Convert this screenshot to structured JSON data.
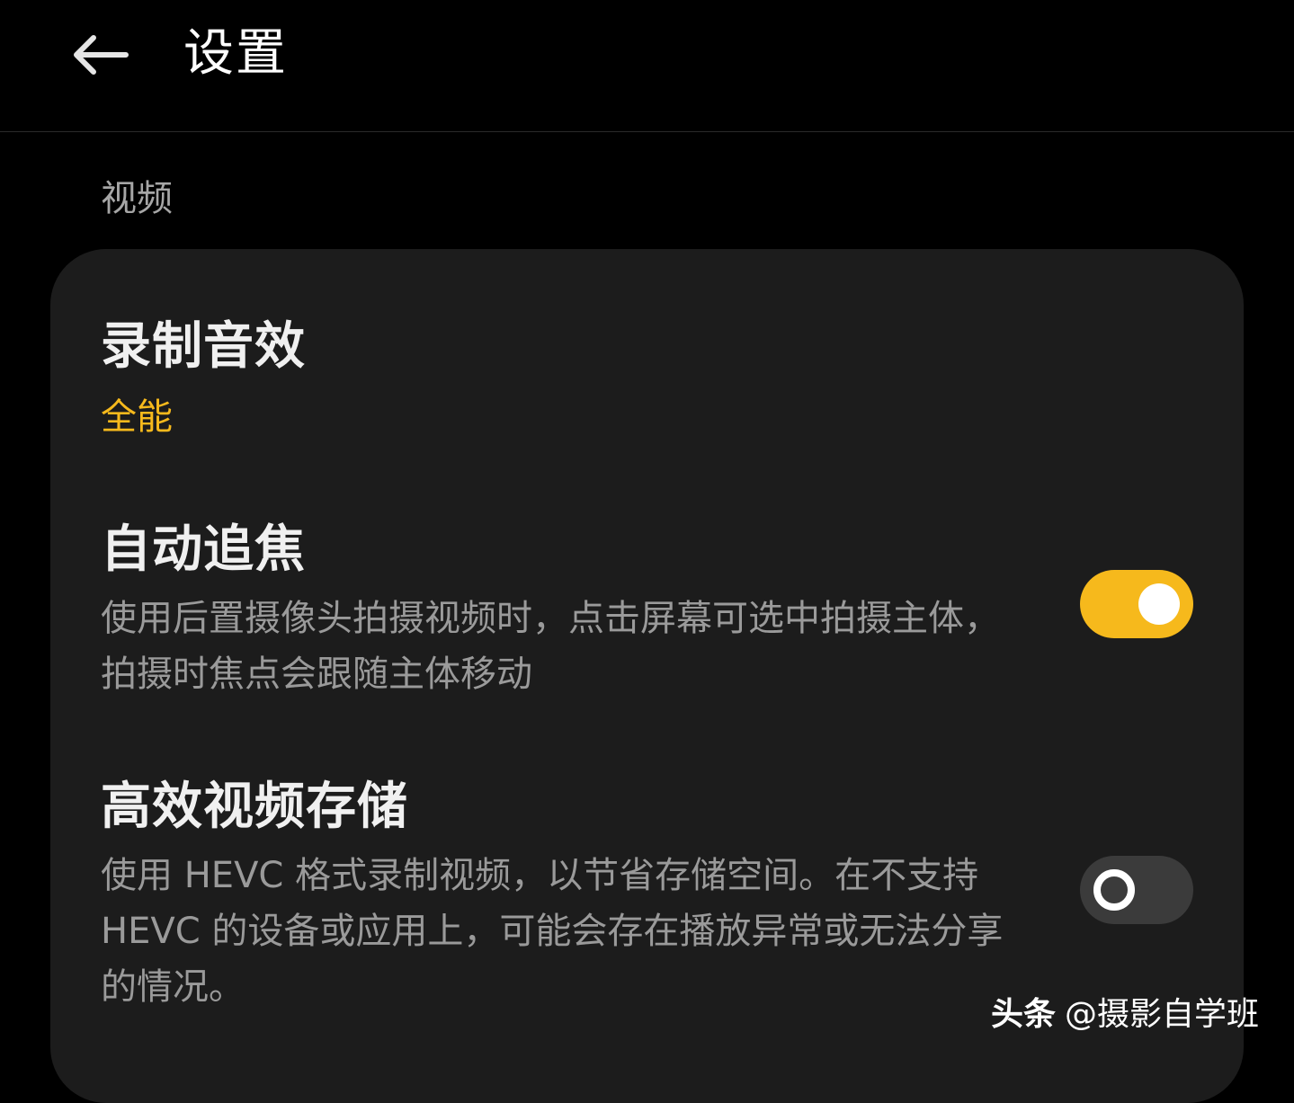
{
  "header": {
    "back_icon": "arrow-left-icon",
    "title": "设置"
  },
  "section": {
    "label": "视频"
  },
  "settings": [
    {
      "title": "录制音效",
      "value": "全能"
    },
    {
      "title": "自动追焦",
      "description": "使用后置摄像头拍摄视频时，点击屏幕可选中拍摄主体，拍摄时焦点会跟随主体移动",
      "toggle_on": true
    },
    {
      "title": "高效视频存储",
      "description": "使用 HEVC 格式录制视频，以节省存储空间。在不支持 HEVC 的设备或应用上，可能会存在播放异常或无法分享的情况。",
      "toggle_on": false
    }
  ],
  "watermark": {
    "brand": "头条",
    "handle": "@摄影自学班"
  },
  "colors": {
    "accent": "#f6b91c",
    "background": "#000000",
    "card": "#1c1c1c",
    "secondary_text": "#9a9a9a"
  }
}
